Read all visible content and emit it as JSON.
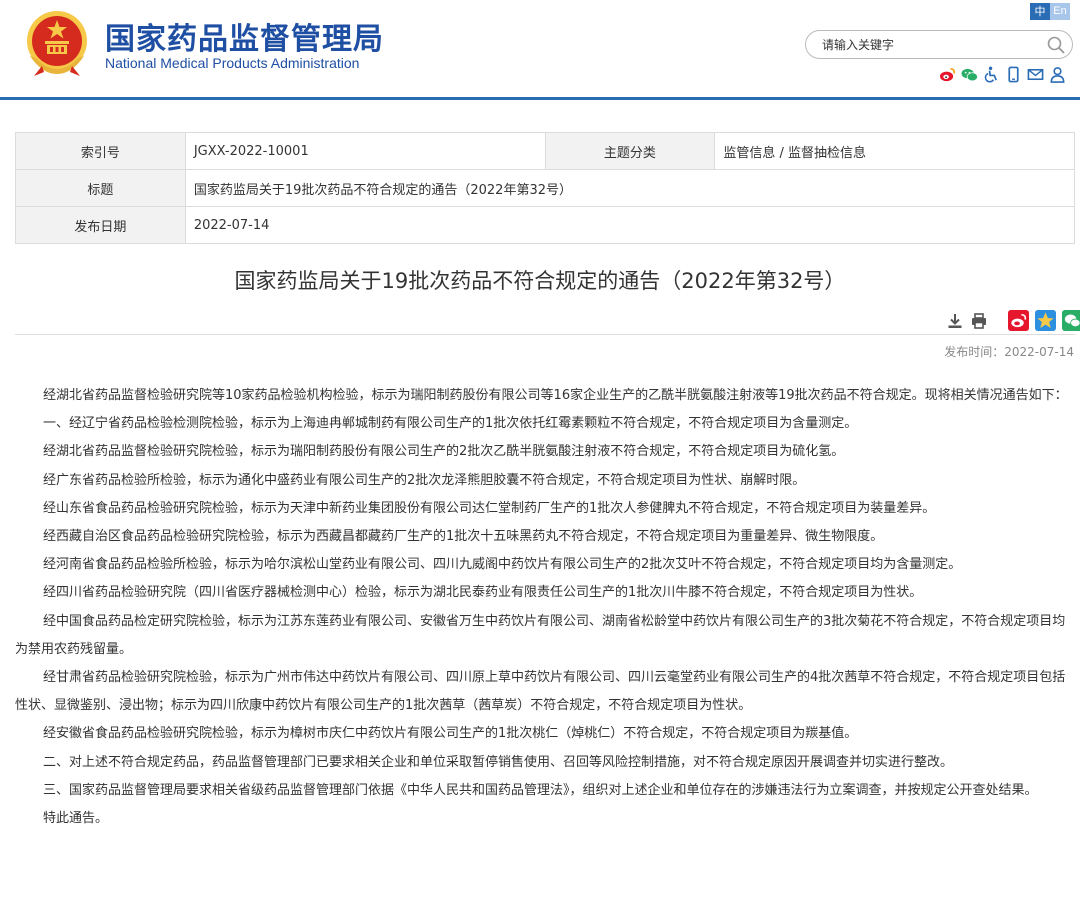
{
  "header": {
    "title_cn": "国家药品监督管理局",
    "title_en": "National Medical Products Administration",
    "lang_zh": "中",
    "lang_en": "En",
    "search_placeholder": "请输入关键字"
  },
  "colors": {
    "brand": "#1f4fa3",
    "accent": "#2a6db5",
    "weibo": "#e6162d",
    "wechat": "#2aae67"
  },
  "icons": [
    "weibo-icon",
    "wechat-icon",
    "accessibility-icon",
    "mobile-icon",
    "mail-icon",
    "user-icon"
  ],
  "meta": {
    "index_label": "索引号",
    "index_value": "JGXX-2022-10001",
    "category_label": "主题分类",
    "category_value": "监管信息 / 监督抽检信息",
    "title_label": "标题",
    "title_value": "国家药监局关于19批次药品不符合规定的通告（2022年第32号）",
    "date_label": "发布日期",
    "date_value": "2022-07-14"
  },
  "article": {
    "title": "国家药监局关于19批次药品不符合规定的通告（2022年第32号）",
    "pubtime": "发布时间：2022-07-14",
    "paragraphs": [
      "经湖北省药品监督检验研究院等10家药品检验机构检验，标示为瑞阳制药股份有限公司等16家企业生产的乙酰半胱氨酸注射液等19批次药品不符合规定。现将相关情况通告如下：",
      "一、经辽宁省药品检验检测院检验，标示为上海迪冉郸城制药有限公司生产的1批次依托红霉素颗粒不符合规定，不符合规定项目为含量测定。",
      "经湖北省药品监督检验研究院检验，标示为瑞阳制药股份有限公司生产的2批次乙酰半胱氨酸注射液不符合规定，不符合规定项目为硫化氢。",
      "经广东省药品检验所检验，标示为通化中盛药业有限公司生产的2批次龙泽熊胆胶囊不符合规定，不符合规定项目为性状、崩解时限。",
      "经山东省食品药品检验研究院检验，标示为天津中新药业集团股份有限公司达仁堂制药厂生产的1批次人参健脾丸不符合规定，不符合规定项目为装量差异。",
      "经西藏自治区食品药品检验研究院检验，标示为西藏昌都藏药厂生产的1批次十五味黑药丸不符合规定，不符合规定项目为重量差异、微生物限度。",
      "经河南省食品药品检验所检验，标示为哈尔滨松山堂药业有限公司、四川九威阁中药饮片有限公司生产的2批次艾叶不符合规定，不符合规定项目均为含量测定。",
      "经四川省药品检验研究院（四川省医疗器械检测中心）检验，标示为湖北民泰药业有限责任公司生产的1批次川牛膝不符合规定，不符合规定项目为性状。",
      "经中国食品药品检定研究院检验，标示为江苏东莲药业有限公司、安徽省万生中药饮片有限公司、湖南省松龄堂中药饮片有限公司生产的3批次菊花不符合规定，不符合规定项目均为禁用农药残留量。",
      "经甘肃省药品检验研究院检验，标示为广州市伟达中药饮片有限公司、四川原上草中药饮片有限公司、四川云毫堂药业有限公司生产的4批次茜草不符合规定，不符合规定项目包括性状、显微鉴别、浸出物；标示为四川欣康中药饮片有限公司生产的1批次茜草（茜草炭）不符合规定，不符合规定项目为性状。",
      "经安徽省食品药品检验研究院检验，标示为樟树市庆仁中药饮片有限公司生产的1批次桃仁（焯桃仁）不符合规定，不符合规定项目为羰基值。",
      "二、对上述不符合规定药品，药品监督管理部门已要求相关企业和单位采取暂停销售使用、召回等风险控制措施，对不符合规定原因开展调查并切实进行整改。",
      "三、国家药品监督管理局要求相关省级药品监督管理部门依据《中华人民共和国药品管理法》，组织对上述企业和单位存在的涉嫌违法行为立案调查，并按规定公开查处结果。",
      "特此通告。"
    ]
  }
}
